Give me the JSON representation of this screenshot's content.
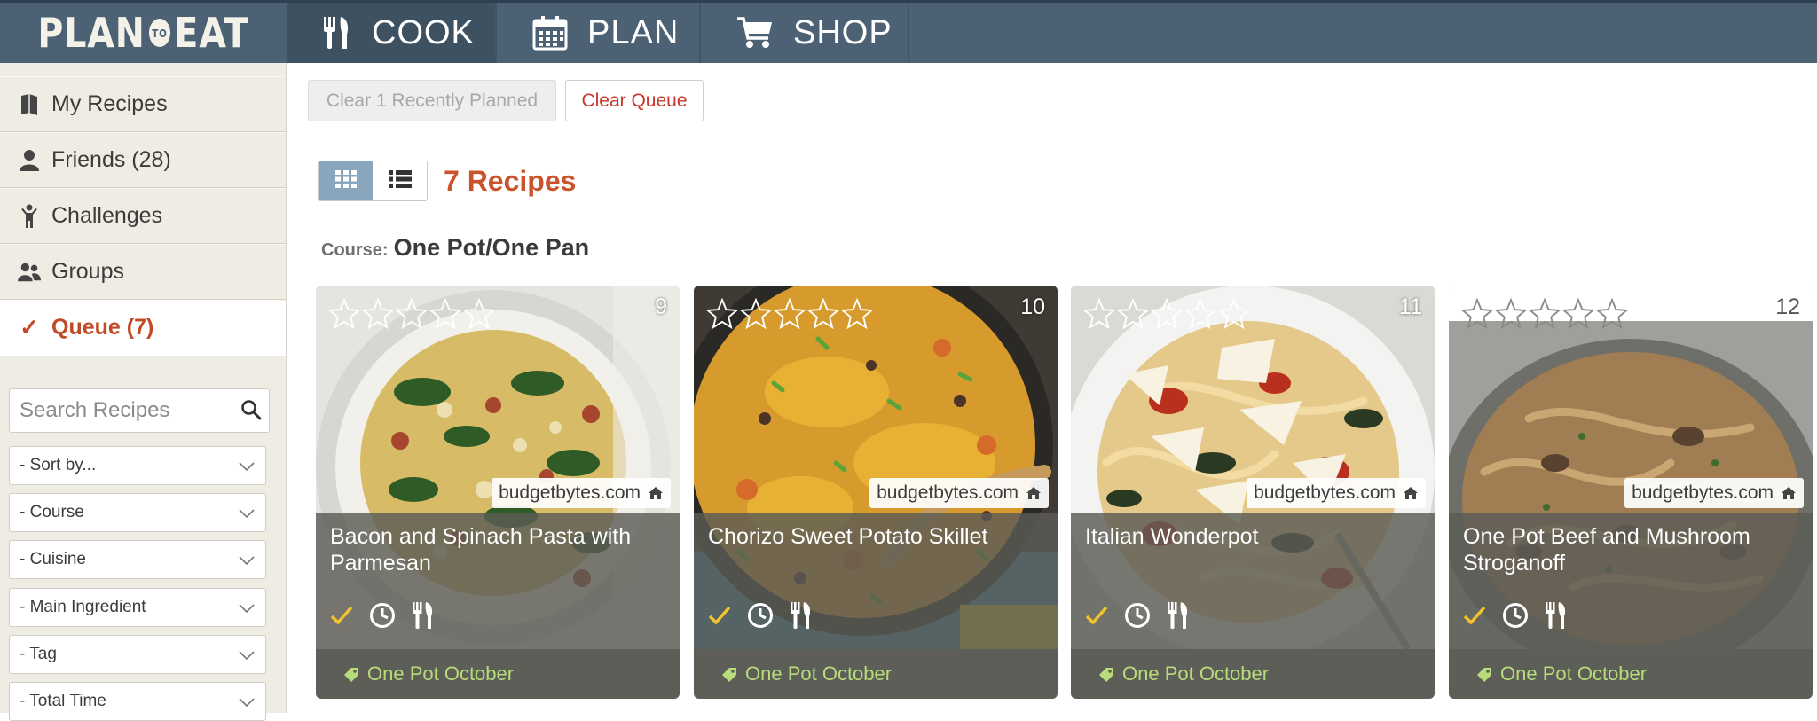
{
  "app": {
    "logo_left": "PLAN",
    "logo_mid": "TO",
    "logo_right": "EAT"
  },
  "nav": {
    "tabs": [
      {
        "label": "COOK",
        "icon": "fork-knife-icon",
        "active": true
      },
      {
        "label": "PLAN",
        "icon": "calendar-icon",
        "active": false
      },
      {
        "label": "SHOP",
        "icon": "cart-icon",
        "active": false
      }
    ]
  },
  "sidebar": {
    "items": [
      {
        "label": "My Recipes",
        "icon": "book-icon"
      },
      {
        "label": "Friends (28)",
        "icon": "person-icon"
      },
      {
        "label": "Challenges",
        "icon": "trophy-person-icon"
      },
      {
        "label": "Groups",
        "icon": "people-icon"
      },
      {
        "label": "Queue (7)",
        "icon": "check-icon",
        "active": true
      }
    ],
    "search": {
      "placeholder": "Search Recipes",
      "value": ""
    },
    "filters": [
      "- Sort by...",
      "- Course",
      "- Cuisine",
      "- Main Ingredient",
      "- Tag",
      "- Total Time"
    ]
  },
  "toolbar": {
    "clear_recent_label": "Clear 1 Recently Planned",
    "clear_queue_label": "Clear Queue"
  },
  "main": {
    "recipe_count": "7 Recipes",
    "view_mode": "grid",
    "course_label": "Course:",
    "course_value": "One Pot/One Pan"
  },
  "recipes": [
    {
      "title": "Bacon and Spinach Pasta with Parmesan",
      "number": "9",
      "source": "budgetbytes.com",
      "tag": "One Pot October",
      "rating": 0
    },
    {
      "title": "Chorizo Sweet Potato Skillet",
      "number": "10",
      "source": "budgetbytes.com",
      "tag": "One Pot October",
      "rating": 0
    },
    {
      "title": "Italian Wonderpot",
      "number": "11",
      "source": "budgetbytes.com",
      "tag": "One Pot October",
      "rating": 0
    },
    {
      "title": "One Pot Beef and Mushroom Stroganoff",
      "number": "12",
      "source": "budgetbytes.com",
      "tag": "One Pot October",
      "rating": 0
    }
  ],
  "colors": {
    "topbar": "#4c6274",
    "accent": "#c9532a",
    "queue_active": "#c24a26",
    "check": "#f2c32d",
    "tag_text": "#b8dc7a"
  }
}
